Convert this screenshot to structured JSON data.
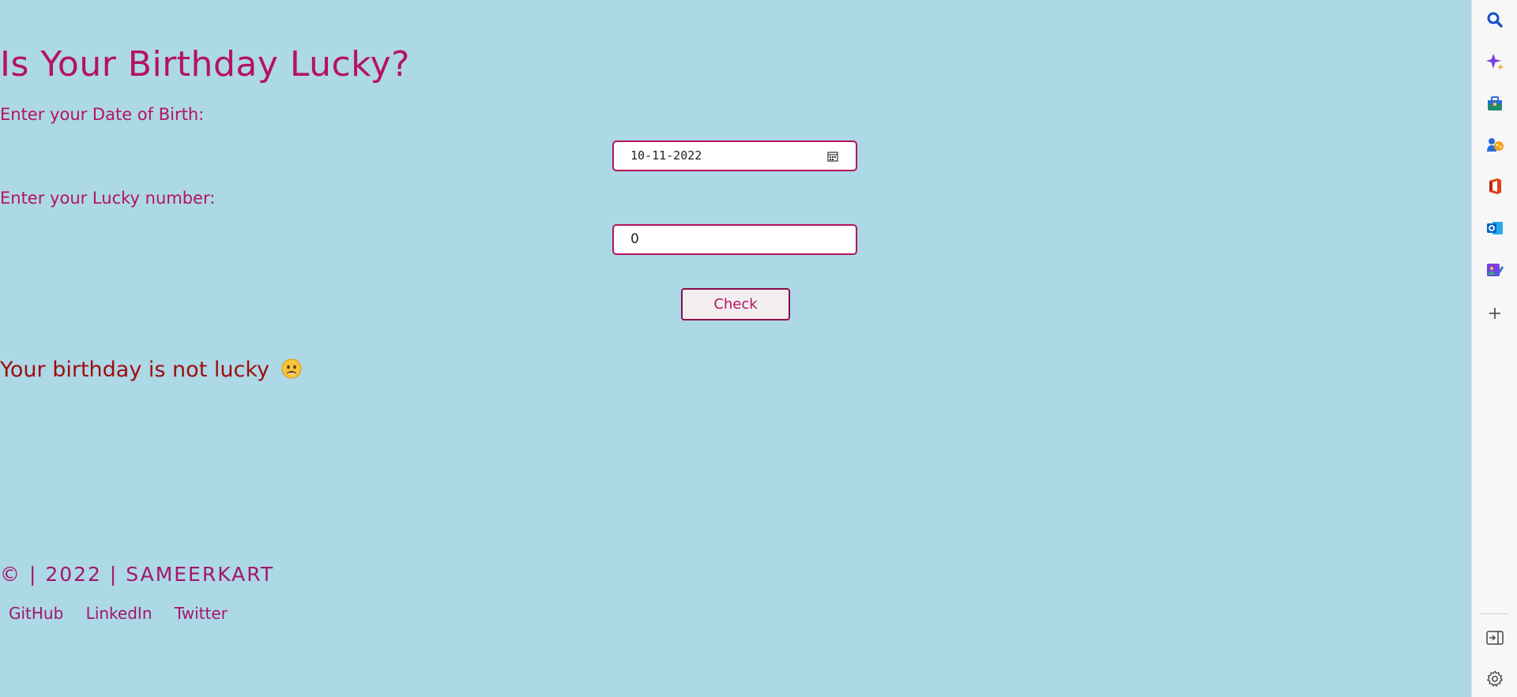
{
  "app": {
    "title": "Is Your Birthday Lucky?",
    "dob_label": "Enter your Date of Birth:",
    "dob_value": "10-11-2022",
    "lucky_label": "Enter your Lucky number:",
    "lucky_value": "0",
    "check_label": "Check",
    "result_text": "Your birthday is not lucky",
    "result_emoji": "worried-face-emoji"
  },
  "footer": {
    "credit": "© | 2022 | SAMEERKART",
    "links": [
      "GitHub",
      "LinkedIn",
      "Twitter"
    ]
  },
  "sidebar": {
    "icons": [
      "search-icon",
      "copilot-icon",
      "shopping-icon",
      "games-icon",
      "office-icon",
      "outlook-icon",
      "designer-icon",
      "add-icon",
      "hide-sidebar-icon",
      "settings-icon"
    ]
  },
  "colors": {
    "background": "#add8e6",
    "accent": "#b5135e",
    "result": "#9e0c0c"
  }
}
